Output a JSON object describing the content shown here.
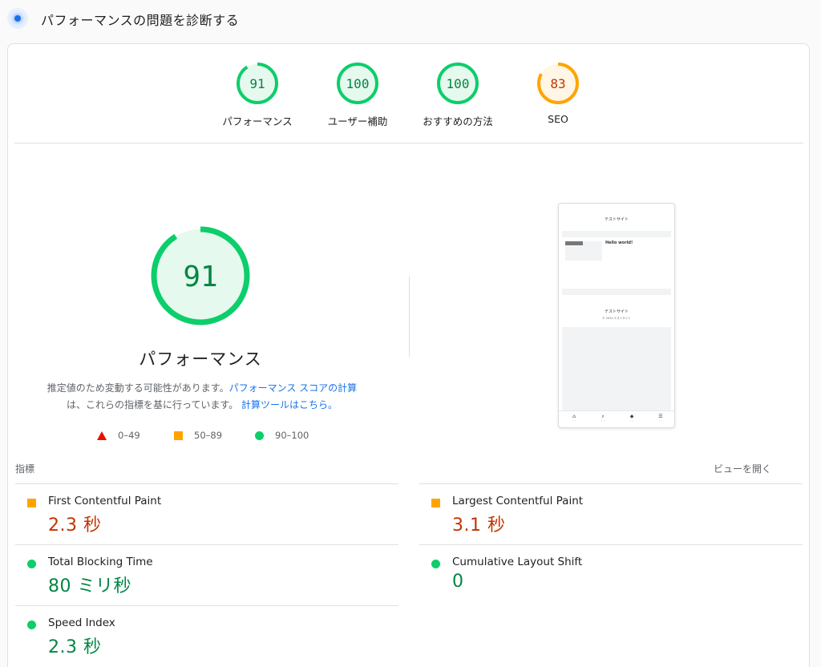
{
  "header": {
    "title": "パフォーマンスの問題を診断する",
    "icon": "lighthouse-icon"
  },
  "categories": [
    {
      "score": 91,
      "label": "パフォーマンス",
      "status": "pass",
      "color": "#0cce6b"
    },
    {
      "score": 100,
      "label": "ユーザー補助",
      "status": "pass",
      "color": "#0cce6b"
    },
    {
      "score": 100,
      "label": "おすすめの方法",
      "status": "pass",
      "color": "#0cce6b"
    },
    {
      "score": 83,
      "label": "SEO",
      "status": "average",
      "color": "#ffa400"
    }
  ],
  "main_gauge": {
    "score": 91,
    "title": "パフォーマンス",
    "color": "#0cce6b"
  },
  "description": {
    "text1": "推定値のため変動する可能性があります。",
    "link1": "パフォーマンス スコアの計算",
    "text2": "は、これらの指標を基に行っています。",
    "link2": "計算ツールはこちら。"
  },
  "legend": [
    {
      "shape": "triangle",
      "range": "0–49",
      "color": "#eb0f00"
    },
    {
      "shape": "square",
      "range": "50–89",
      "color": "#ffa400"
    },
    {
      "shape": "circle",
      "range": "90–100",
      "color": "#0cce6b"
    }
  ],
  "screenshot": {
    "site_title": "テストサイト",
    "post_title": "Hello world!",
    "footer_title": "テストサイト",
    "copyright": "© 2024 テストサイト"
  },
  "metrics_section": {
    "heading": "指標",
    "view_toggle": "ビューを開く"
  },
  "metrics": [
    {
      "name": "First Contentful Paint",
      "value": "2.3 秒",
      "status": "average"
    },
    {
      "name": "Largest Contentful Paint",
      "value": "3.1 秒",
      "status": "average"
    },
    {
      "name": "Total Blocking Time",
      "value": "80 ミリ秒",
      "status": "pass"
    },
    {
      "name": "Cumulative Layout Shift",
      "value": "0",
      "status": "pass"
    },
    {
      "name": "Speed Index",
      "value": "2.3 秒",
      "status": "pass"
    }
  ],
  "colors": {
    "pass": "#0cce6b",
    "pass_text": "#018642",
    "average": "#ffa400",
    "average_text": "#c33300",
    "fail": "#eb0f00",
    "link": "#1a73e8"
  }
}
